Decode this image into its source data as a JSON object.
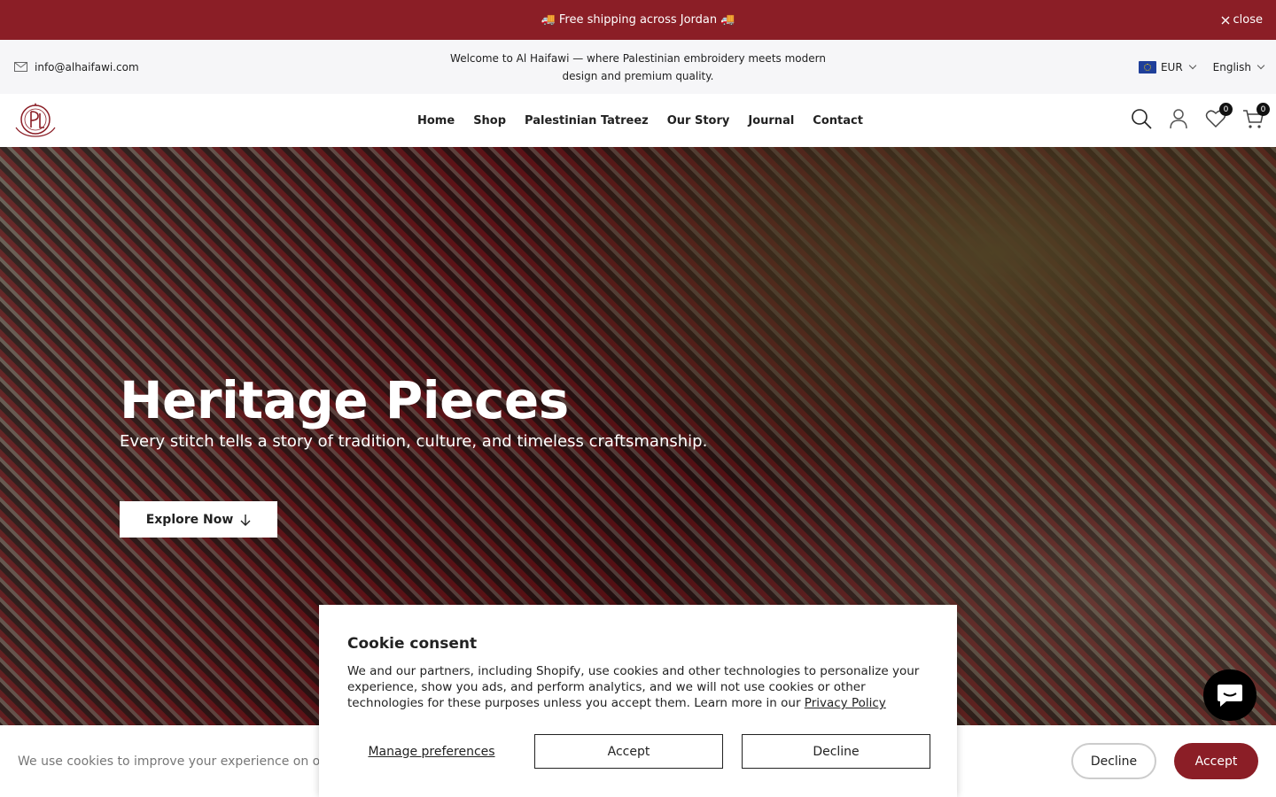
{
  "announcement": {
    "text": "🚚 Free shipping across Jordan 🚚",
    "close_label": "close"
  },
  "topbar": {
    "email": "info@alhaifawi.com",
    "welcome": "Welcome to Al Haifawi — where Palestinian embroidery meets modern design and premium quality.",
    "currency": "EUR",
    "language": "English"
  },
  "nav": {
    "items": [
      "Home",
      "Shop",
      "Palestinian Tatreez",
      "Our Story",
      "Journal",
      "Contact"
    ]
  },
  "header_icons": {
    "wishlist_count": "0",
    "cart_count": "0"
  },
  "hero": {
    "title": "Heritage Pieces",
    "subtitle": "Every stitch tells a story of tradition, culture, and timeless craftsmanship.",
    "button": "Explore Now"
  },
  "cookie_bar": {
    "message": "We use cookies to improve your experience on o",
    "decline": "Decline",
    "accept": "Accept"
  },
  "consent_modal": {
    "title": "Cookie consent",
    "body": "We and our partners, including Shopify, use cookies and other technologies to personalize your experience, show you ads, and perform analytics, and we will not use cookies or other technologies for these purposes unless you accept them. Learn more in our ",
    "link": "Privacy Policy",
    "manage": "Manage preferences",
    "accept": "Accept",
    "decline": "Decline"
  },
  "colors": {
    "brand": "#8b1e26",
    "topbar_bg": "#f6f6f8"
  }
}
